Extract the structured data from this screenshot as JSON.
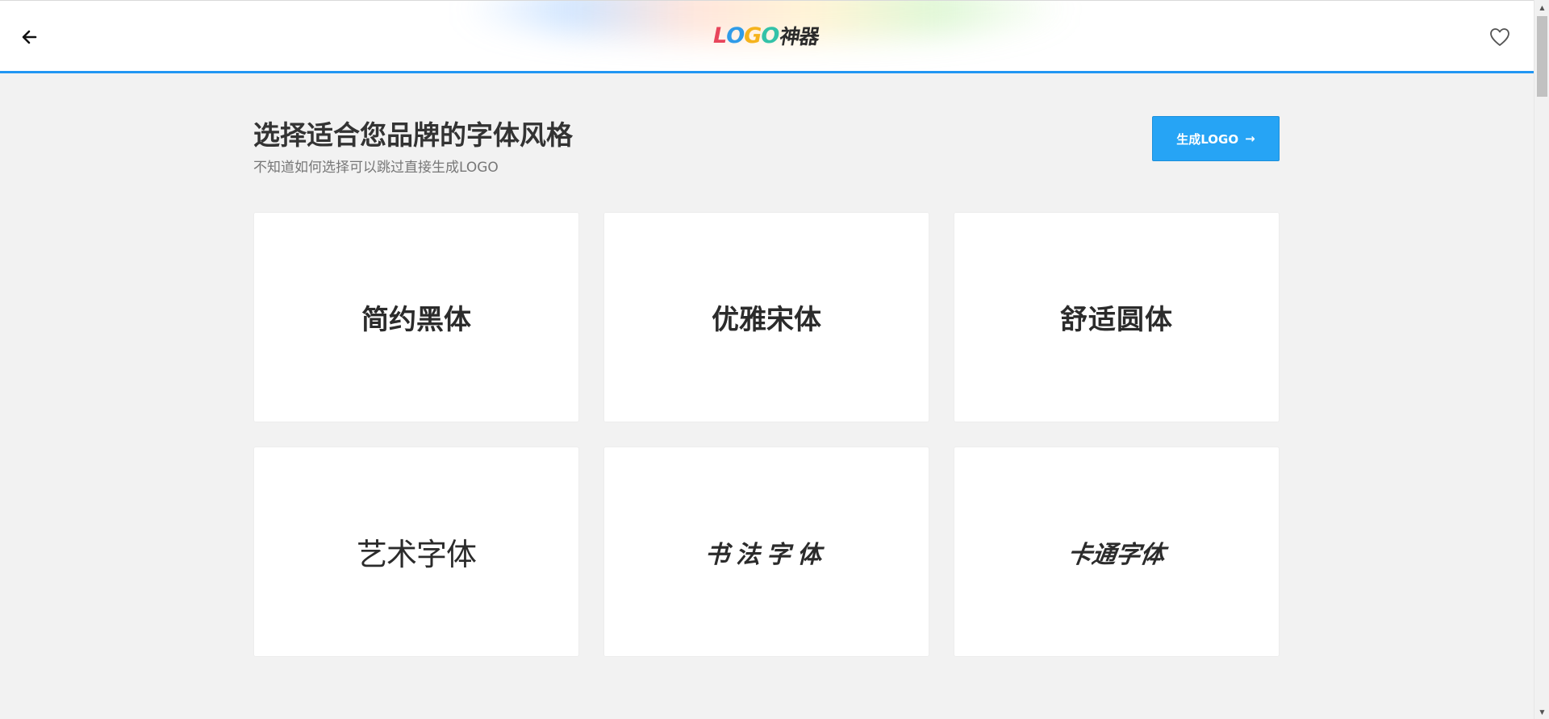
{
  "header": {
    "logo": {
      "letters": [
        "L",
        "O",
        "G",
        "O"
      ],
      "cn": "神器"
    },
    "back_icon": "arrow-left-icon",
    "favorite_icon": "heart-outline-icon"
  },
  "main": {
    "title": "选择适合您品牌的字体风格",
    "subtitle": "不知道如何选择可以跳过直接生成LOGO",
    "generate_button": {
      "label": "生成LOGO",
      "arrow": "→"
    },
    "font_styles": [
      {
        "label": "简约黑体"
      },
      {
        "label": "优雅宋体"
      },
      {
        "label": "舒适圆体"
      },
      {
        "label": "艺术字体"
      },
      {
        "label": "书法字体"
      },
      {
        "label": "卡通字体"
      }
    ]
  },
  "colors": {
    "accent": "#2196f3",
    "button": "#26a4f5",
    "background": "#f2f2f2"
  }
}
